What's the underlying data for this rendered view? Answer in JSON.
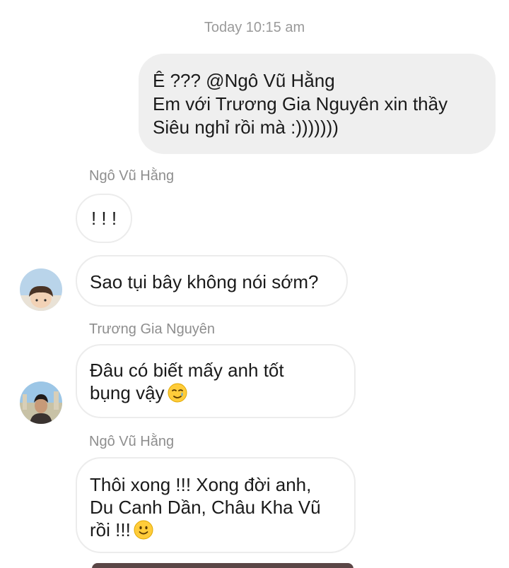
{
  "timestamp": "Today 10:15 am",
  "outgoing": {
    "lines": [
      "Ê ??? @Ngô Vũ Hằng",
      "Em với Trương Gia Nguyên xin thầy",
      "Siêu nghỉ rồi mà :)))))))"
    ]
  },
  "messages": [
    {
      "sender": "Ngô Vũ Hằng",
      "lines": [
        "! ! !"
      ]
    },
    {
      "lines": [
        "Sao tụi bây không nói sớm?"
      ]
    },
    {
      "sender": "Trương Gia Nguyên",
      "lines": [
        "Đâu có biết mấy anh tốt",
        "bụng vậy"
      ],
      "emoji": "smiling-face-with-tear-icon"
    },
    {
      "sender": "Ngô Vũ Hằng",
      "lines": [
        "Thôi xong !!! Xong đời anh,",
        "Du Canh Dần, Châu Kha Vũ",
        "rồi !!!"
      ],
      "emoji": "slightly-smiling-face-icon"
    }
  ]
}
